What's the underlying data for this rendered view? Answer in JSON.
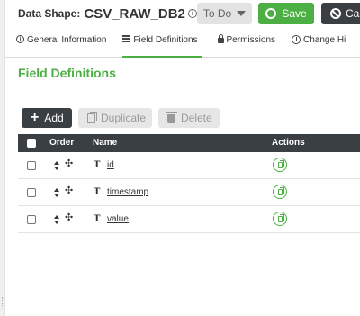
{
  "header": {
    "title_label": "Data Shape:",
    "title_name": "CSV_RAW_DB2",
    "todo_label": "To Do",
    "save_label": "Save",
    "cancel_label": "Ca"
  },
  "tabs": [
    {
      "label": "General Information",
      "icon": "info-icon"
    },
    {
      "label": "Field Definitions",
      "icon": "list-icon",
      "active": true
    },
    {
      "label": "Permissions",
      "icon": "lock-icon"
    },
    {
      "label": "Change Hi",
      "icon": "clock-icon"
    }
  ],
  "section": {
    "title": "Field Definitions"
  },
  "toolbar": {
    "add_label": "Add",
    "duplicate_label": "Duplicate",
    "delete_label": "Delete"
  },
  "table": {
    "headers": {
      "order": "Order",
      "name": "Name",
      "actions": "Actions"
    },
    "rows": [
      {
        "name": "id",
        "type_icon": "T"
      },
      {
        "name": "timestamp",
        "type_icon": "T"
      },
      {
        "name": "value",
        "type_icon": "T"
      }
    ]
  },
  "colors": {
    "accent": "#4caf43",
    "dark": "#3a3f44"
  }
}
